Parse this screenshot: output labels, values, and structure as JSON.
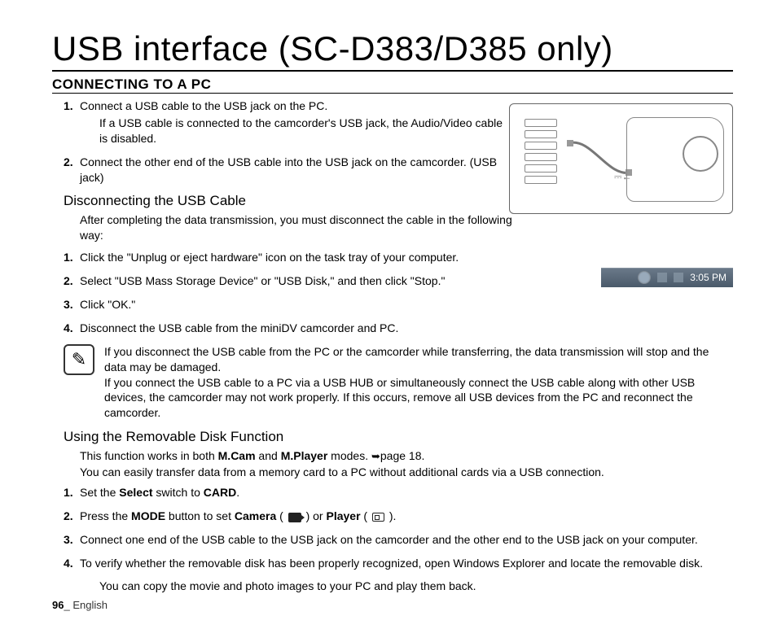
{
  "page_title": "USB interface (SC-D383/D385 only)",
  "section_title": "CONNECTING TO A PC",
  "connect_steps": [
    {
      "text": "Connect a USB cable to the USB jack on the PC.",
      "note": "If a USB cable is connected to the camcorder's USB jack, the Audio/Video cable is disabled."
    },
    {
      "text": "Connect the other end of the USB cable into the USB jack on the camcorder. (USB jack)"
    }
  ],
  "disconnect": {
    "title": "Disconnecting the USB Cable",
    "intro": "After completing the data transmission, you must disconnect the cable in the following way:",
    "steps": [
      "Click the \"Unplug or eject hardware\" icon on the task tray of your computer.",
      "Select \"USB Mass Storage Device\" or \"USB Disk,\" and then click \"Stop.\"",
      "Click \"OK.\"",
      "Disconnect the USB cable from the miniDV camcorder and PC."
    ]
  },
  "warning": {
    "icon_name": "note-icon",
    "lines": [
      "If you disconnect the USB cable from the PC or the camcorder while transferring, the data transmission will stop and the data may be damaged.",
      "If you connect the USB cable to a PC via a USB HUB or simultaneously connect the USB cable along with other USB devices, the camcorder may not work properly. If this occurs, remove all USB devices from the PC and reconnect the camcorder."
    ]
  },
  "removable": {
    "title": "Using the Removable Disk Function",
    "intro_pre": "This function works in both ",
    "mcam": "M.Cam",
    "intro_mid1": " and ",
    "mplayer": "M.Player",
    "intro_mid2": " modes. ",
    "page_ref": "page 18.",
    "intro_line2": "You can easily transfer data from a memory card to a PC without additional cards via a USB connection.",
    "steps": {
      "s1_pre": "Set the ",
      "s1_b1": "Select",
      "s1_mid": " switch to ",
      "s1_b2": "CARD",
      "s1_post": ".",
      "s2_pre": "Press the ",
      "s2_b1": "MODE",
      "s2_mid1": " button to set ",
      "s2_b2": "Camera",
      "s2_mid2": " ( ",
      "s2_mid3": " ) or ",
      "s2_b3": "Player",
      "s2_mid4": " ( ",
      "s2_post": " ).",
      "s3": "Connect one end of the USB cable to the USB jack on the camcorder and the other end to the USB jack on your computer.",
      "s4": "To verify whether the removable disk has been properly recognized, open Windows Explorer and locate the removable disk."
    },
    "final": "You can copy the movie and photo images to your PC and play them back."
  },
  "taskbar_time": "3:05 PM",
  "footer": {
    "page": "96",
    "sep": "_ ",
    "lang": "English"
  }
}
